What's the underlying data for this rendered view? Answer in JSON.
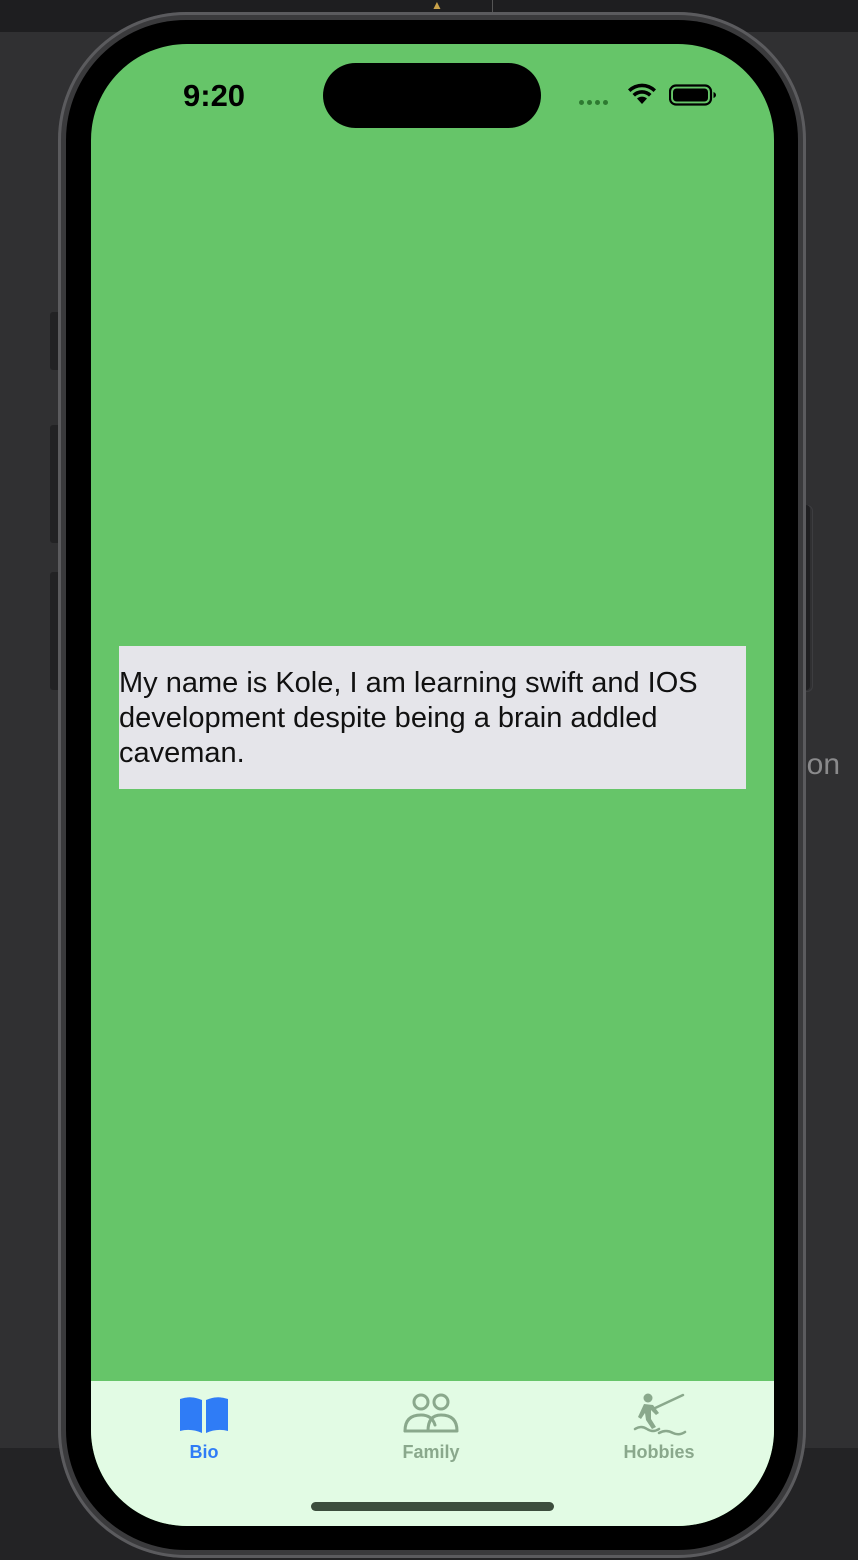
{
  "status_bar": {
    "time": "9:20",
    "icons": [
      "signal-dots-icon",
      "wifi-icon",
      "battery-icon"
    ]
  },
  "background": {
    "side_text": "ion"
  },
  "main": {
    "bio_text": "My name is Kole, I am learning swift and IOS development despite being a brain addled caveman."
  },
  "tab_bar": {
    "tabs": [
      {
        "label": "Bio",
        "icon": "book-icon",
        "selected": true
      },
      {
        "label": "Family",
        "icon": "people-icon",
        "selected": false
      },
      {
        "label": "Hobbies",
        "icon": "fishing-figure-icon",
        "selected": false
      }
    ]
  },
  "colors": {
    "screen_background": "#66c569",
    "text_box_background": "#e5e5ea",
    "tab_bar_background": "#e2fbe4",
    "tab_active": "#2f7cf6",
    "tab_inactive": "#8aa88c"
  }
}
